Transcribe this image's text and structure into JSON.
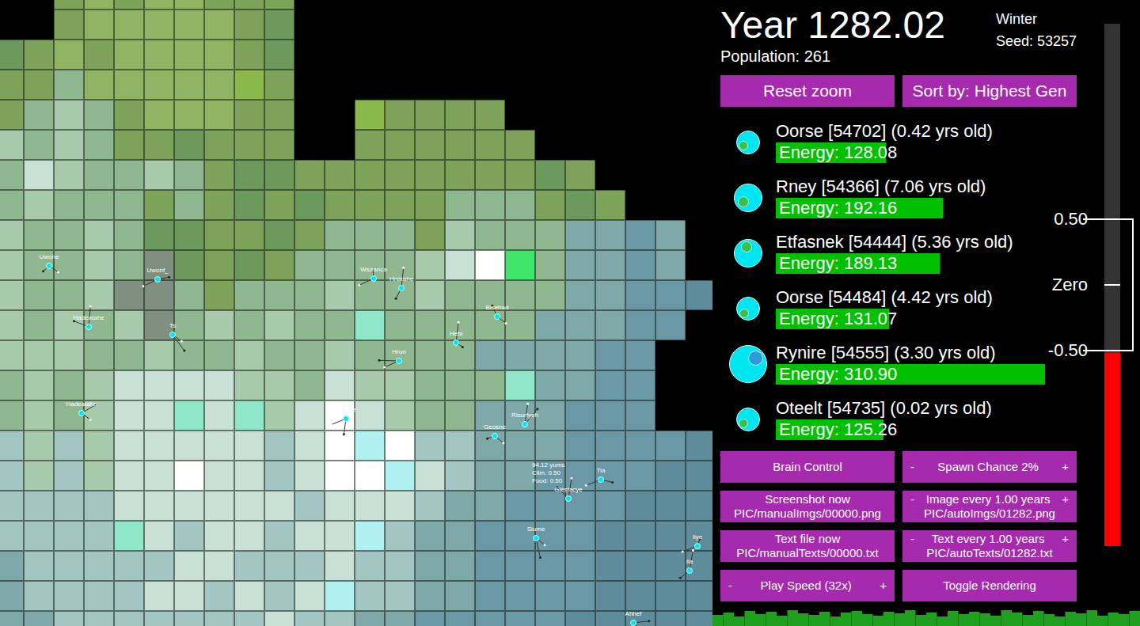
{
  "header": {
    "year": "Year 1282.02",
    "season": "Winter",
    "seed": "Seed: 53257",
    "population": "Population: 261"
  },
  "top_buttons": [
    "Reset zoom",
    "Sort by: Highest Gen"
  ],
  "creature_list": [
    {
      "name": "Oorse [54702] (0.42 yrs old)",
      "energy": "Energy: 128.08",
      "level": 0.41,
      "color": "#3cbf4a"
    },
    {
      "name": "Rney [54366] (7.06 yrs old)",
      "energy": "Energy: 192.16",
      "level": 0.62,
      "color": "#3cbf4a"
    },
    {
      "name": "Etfasnek [54444] (5.36 yrs old)",
      "energy": "Energy: 189.13",
      "level": 0.61,
      "color": "#3cbf4a"
    },
    {
      "name": "Oorse [54484] (4.42 yrs old)",
      "energy": "Energy: 131.07",
      "level": 0.42,
      "color": "#3cbf4a"
    },
    {
      "name": "Rynire [54555] (3.30 yrs old)",
      "energy": "Energy: 310.90",
      "level": 1.0,
      "color": "#2f9ad8"
    },
    {
      "name": "Oteelt [54735] (0.02 yrs old)",
      "energy": "Energy: 125.26",
      "level": 0.4,
      "color": "#3cbf4a"
    }
  ],
  "control_buttons": [
    {
      "kind": "plain",
      "label": "Brain Control"
    },
    {
      "kind": "stepper",
      "minus": "-",
      "label": "Spawn Chance 2%",
      "plus": "+",
      "sub": ""
    },
    {
      "kind": "file",
      "label": "Screenshot now",
      "sub": "PIC/manualImgs/00000.png"
    },
    {
      "kind": "stepper",
      "minus": "-",
      "label": "Image every 1.00 years",
      "plus": "+",
      "sub": "PIC/autoImgs/01282.png"
    },
    {
      "kind": "file",
      "label": "Text file now",
      "sub": "PIC/manualTexts/00000.txt"
    },
    {
      "kind": "stepper",
      "minus": "-",
      "label": "Text every 1.00 years",
      "plus": "+",
      "sub": "PIC/autoTexts/01282.txt"
    },
    {
      "kind": "stepper",
      "minus": "-",
      "label": "Play Speed (32x)",
      "plus": "+",
      "sub": ""
    },
    {
      "kind": "plain",
      "label": "Toggle Rendering"
    }
  ],
  "temperature_slider": {
    "level": 0.37,
    "ticks": [
      "0.50",
      "Zero",
      "-0.50"
    ]
  },
  "map": {
    "palette": {
      ".": "#000000",
      "g": "#7da35a",
      "G": "#8fb464",
      "l": "#8ab84a",
      "d": "#6b9a5c",
      "m": "#8fb890",
      "p": "#a9c9ac",
      "w": "#c9e0d6",
      "W": "#ffffff",
      "c": "#a3c6c2",
      "t": "#7fa9a8",
      "b": "#6a98a4",
      "B": "#5f8c9a",
      "a": "#8fe6c8",
      "A": "#b0f0f0",
      "L": "#3ee66a",
      "r": "#7f8f80"
    },
    "rows": [
      "..gGgGGggg..............",
      "..gGGGGGgd..............",
      "dgGgGGGGgd..............",
      "ggmGGGGGlg..............",
      "gmpmgGGGgg..lgggg.......",
      "pmpmggdggg..gggggg......",
      "mwpmmpmgddggggggggdg....",
      "mpmmmgmgdgdggggmmmgdg...",
      "pmmpmddggdgmmmgpmmmttbt.",
      "pmmpmrdgdgmmmmpwWLmttbt.",
      "pmmprrmgmmmpmmpmmmmttbbB",
      "pmpmprmpmpmmammmmmtttbb.",
      "pppmmpmmpmmpmmmmttttbb..",
      "mpmpwwwwppmwppmmmattbb..",
      "mpmpwwawapwWwpmmtttbbb..",
      "cpcpwwwwwcwWAWcctttbbbbB",
      "cpcpwwWwwcwWWAwcttbbbbBB",
      "ccccwwwwwwcwwwcttbbbbBBB",
      "ccccawcwwcwwActtbbbbBBBB",
      "tcccccwwcccwccttbbbbBBBB",
      "tccccwwcwcwAccttbbbbBBBB",
      "ttcccccccwccttbbbbbBBBBB"
    ],
    "creatures": [
      {
        "name": "Uwone"
      },
      {
        "name": "Uwonf_"
      },
      {
        "name": "Hadeatahe"
      },
      {
        "name": "Ts"
      },
      {
        "name": "Wsaanca"
      },
      {
        "name": "Hnatahe"
      },
      {
        "name": "Hadeatahe"
      },
      {
        "name": "Hron"
      },
      {
        "name": "Hebi"
      },
      {
        "name": "Bisehad"
      },
      {
        "name": "Huaiee"
      },
      {
        "name": "Risurfyeh"
      },
      {
        "name": "Geosne"
      },
      {
        "name": "Tla"
      },
      {
        "name": "Giesfacye"
      },
      {
        "name": "Siume"
      },
      {
        "name": "Iiye"
      },
      {
        "name": "Ila"
      },
      {
        "name": "Ahhef"
      }
    ],
    "tile_info": [
      "94.12 yums",
      "Clim. 0.50",
      "Food: 0.50"
    ]
  },
  "population_chart": {
    "values": [
      14,
      17,
      12,
      19,
      15,
      18,
      13,
      20,
      16,
      14,
      18,
      12,
      17,
      19,
      15,
      13,
      18,
      16,
      20,
      14,
      17,
      12,
      19,
      15,
      18,
      16,
      13,
      20,
      17,
      14,
      19,
      15,
      12,
      18,
      16,
      20,
      13,
      17,
      15,
      19
    ]
  }
}
